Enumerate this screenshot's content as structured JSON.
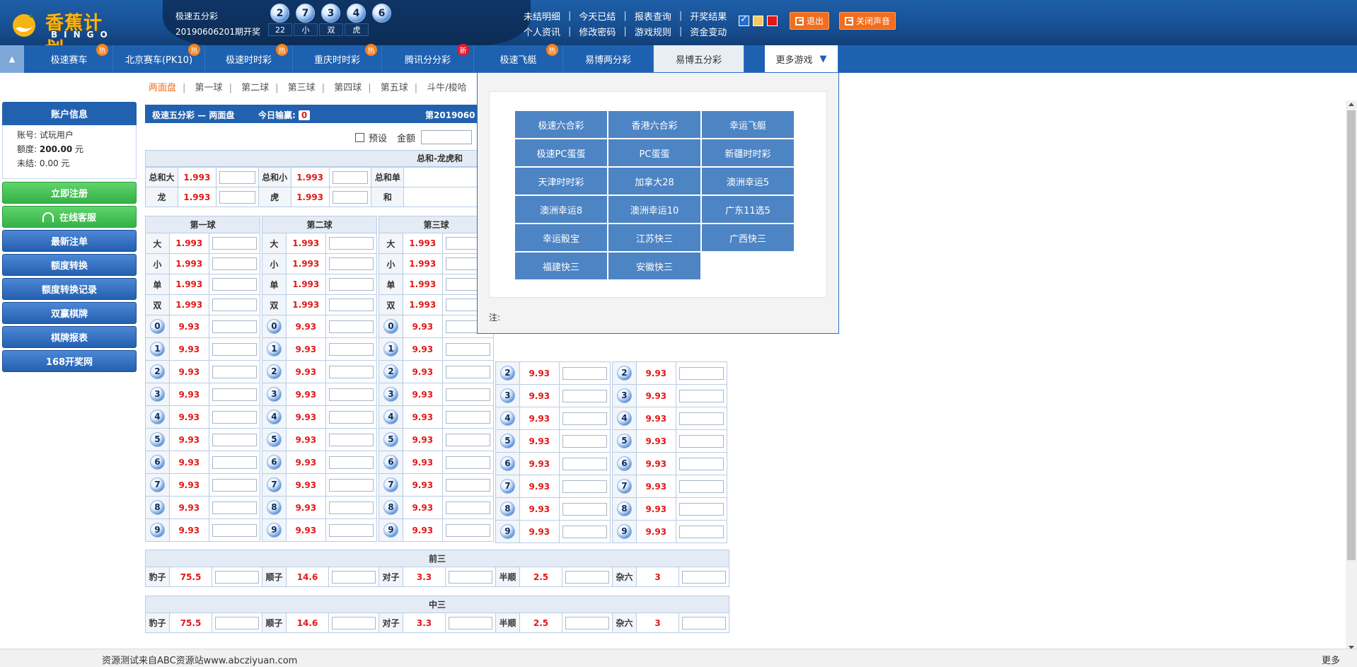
{
  "header": {
    "logo_title": "香蕉计划",
    "logo_sub": "BINGO",
    "game_name": "极速五分彩",
    "period_text": "20190606201期开奖",
    "balls": [
      "2",
      "7",
      "3",
      "4",
      "6"
    ],
    "stats": [
      "22",
      "小",
      "双",
      "虎"
    ],
    "nav_row1": [
      "未结明细",
      "今天已结",
      "报表查询",
      "开奖结果"
    ],
    "nav_row2": [
      "个人资讯",
      "修改密码",
      "游戏规则",
      "资金变动"
    ],
    "logout_label": "退出",
    "mute_label": "关闭声音",
    "colors": {
      "header_bg": "#1f5fa8",
      "accent_orange": "#f26d1d"
    }
  },
  "game_tabs": [
    {
      "label": "极速赛车",
      "badge": "热"
    },
    {
      "label": "北京赛车(PK10)",
      "badge": "热"
    },
    {
      "label": "极速时时彩",
      "badge": "热"
    },
    {
      "label": "重庆时时彩",
      "badge": "热"
    },
    {
      "label": "腾讯分分彩",
      "badge": "新"
    },
    {
      "label": "极速飞艇",
      "badge": "热"
    },
    {
      "label": "易博两分彩",
      "badge": ""
    },
    {
      "label": "易博五分彩",
      "badge": ""
    }
  ],
  "more_games_label": "更多游戏",
  "more_games_arrow": "▼",
  "collapse_icon": "▲",
  "subnav": [
    "两面盘",
    "第一球",
    "第二球",
    "第三球",
    "第四球",
    "第五球",
    "斗牛/梭哈"
  ],
  "account": {
    "title": "账户信息",
    "account_label": "账号:",
    "account_value": "试玩用户",
    "quota_label": "额度:",
    "quota_value": "200.00",
    "quota_unit": "元",
    "unsettled_label": "未结:",
    "unsettled_value": "0.00 元"
  },
  "sidebar_buttons": [
    "立即注册",
    "在线客服",
    "最新注单",
    "额度转换",
    "额度转换记录",
    "双赢棋牌",
    "棋牌报表",
    "168开奖网"
  ],
  "board": {
    "title": "极速五分彩 — 两面盘",
    "today_label": "今日输赢:",
    "today_value": "0",
    "period_prefix": "第2019060",
    "preset_label": "预设",
    "amount_label": "金额",
    "zonghe_header": "总和-龙虎和",
    "zonghe_row1": [
      [
        "总和大",
        "1.993"
      ],
      [
        "总和小",
        "1.993"
      ],
      [
        "总和单",
        ""
      ]
    ],
    "zonghe_row2": [
      [
        "龙",
        "1.993"
      ],
      [
        "虎",
        "1.993"
      ],
      [
        "和",
        ""
      ]
    ]
  },
  "ball_cols": [
    {
      "title": "第一球"
    },
    {
      "title": "第二球"
    },
    {
      "title": "第三球"
    }
  ],
  "ball_rows_top": [
    [
      "大",
      "1.993"
    ],
    [
      "小",
      "1.993"
    ],
    [
      "单",
      "1.993"
    ],
    [
      "双",
      "1.993"
    ]
  ],
  "digits": [
    "0",
    "1",
    "2",
    "3",
    "4",
    "5",
    "6",
    "7",
    "8",
    "9"
  ],
  "digit_odds": "9.93",
  "combo_sections": [
    {
      "title": "前三",
      "items": [
        [
          "豹子",
          "75.5"
        ],
        [
          "顺子",
          "14.6"
        ],
        [
          "对子",
          "3.3"
        ],
        [
          "半顺",
          "2.5"
        ],
        [
          "杂六",
          "3"
        ]
      ]
    },
    {
      "title": "中三",
      "items": [
        [
          "豹子",
          "75.5"
        ],
        [
          "顺子",
          "14.6"
        ],
        [
          "对子",
          "3.3"
        ],
        [
          "半顺",
          "2.5"
        ],
        [
          "杂六",
          "3"
        ]
      ]
    }
  ],
  "more_panel": {
    "games": [
      "极速六合彩",
      "香港六合彩",
      "幸运飞艇",
      "极速PC蛋蛋",
      "PC蛋蛋",
      "新疆时时彩",
      "天津时时彩",
      "加拿大28",
      "澳洲幸运5",
      "澳洲幸运8",
      "澳洲幸运10",
      "广东11选5",
      "幸运骰宝",
      "江苏快三",
      "广西快三",
      "福建快三",
      "安徽快三"
    ],
    "note_label": "注:"
  },
  "footer": {
    "source_text": "资源测试来自ABC资源站www.abcziyuan.com",
    "more_label": "更多"
  }
}
